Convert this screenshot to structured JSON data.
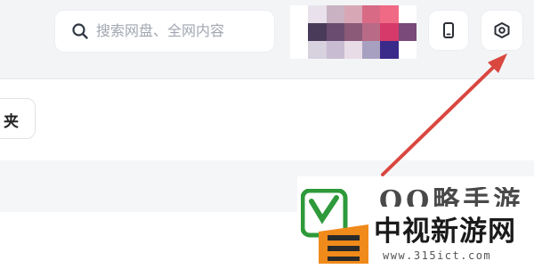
{
  "header": {
    "search": {
      "placeholder": "搜索网盘、全网内容",
      "icon": "search-icon"
    },
    "avatar_colors": [
      "#ffffff",
      "#e9e2ec",
      "#c9b3c3",
      "#d8a7b6",
      "#d86a86",
      "#f06a86",
      "#ffffff",
      "#ffffff",
      "#4a3a5a",
      "#6a4c70",
      "#8a5a78",
      "#b86a86",
      "#d63a6a",
      "#7a4a7a",
      "#ffffff",
      "#d8d2de",
      "#c8bcd2",
      "#e8dce6",
      "#a8a0c0",
      "#3a2a8a",
      "#ffffff"
    ],
    "phone_button": {
      "icon": "mobile-phone-icon"
    },
    "settings_button": {
      "icon": "settings-gear-icon"
    }
  },
  "toolbar": {
    "folder_button_label": "夹"
  },
  "annotation": {
    "arrow_color": "#d9473f",
    "target": "settings_button"
  },
  "watermark": {
    "top_text": "QQ略手游",
    "main_text": "中视新游网",
    "url": "www.315ict.com",
    "logo_colors": {
      "green": "#2e9a3a",
      "orange": "#f08a1a",
      "dark": "#2a2a2a"
    }
  }
}
